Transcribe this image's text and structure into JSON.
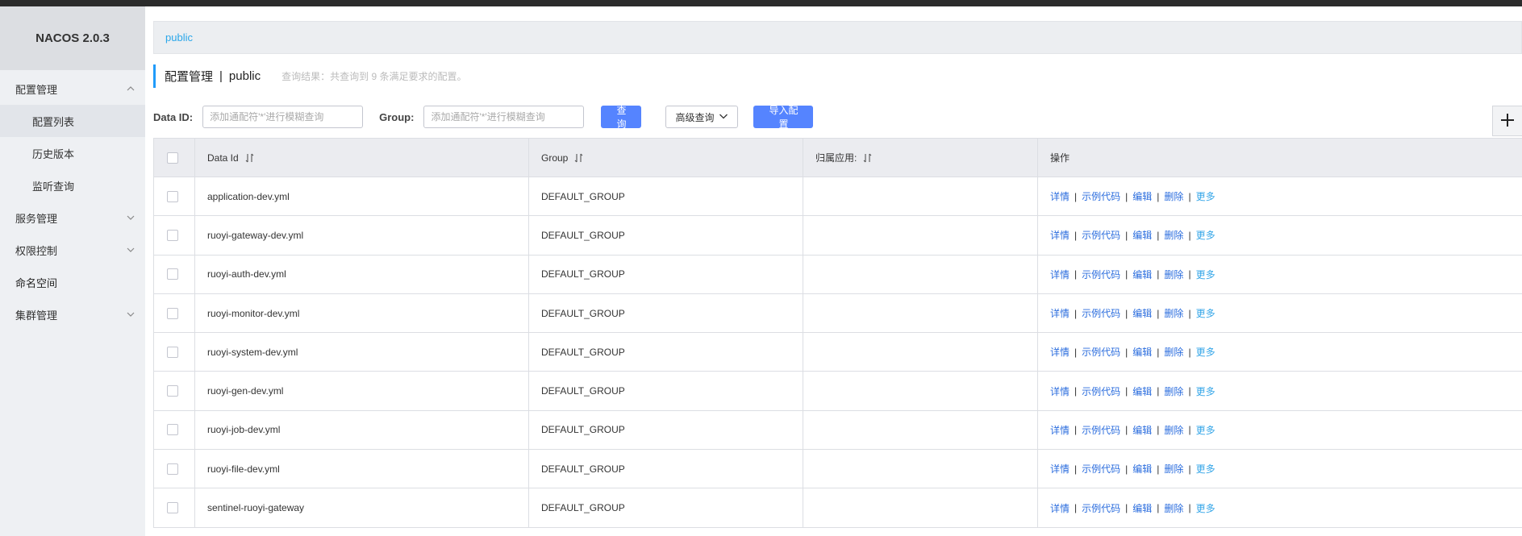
{
  "app": {
    "brand": "NACOS 2.0.3"
  },
  "sidebar": {
    "items": [
      {
        "label": "配置管理",
        "expanded": true
      },
      {
        "label": "配置列表",
        "sub": true,
        "active": true
      },
      {
        "label": "历史版本",
        "sub": true
      },
      {
        "label": "监听查询",
        "sub": true
      },
      {
        "label": "服务管理",
        "expanded": false
      },
      {
        "label": "权限控制",
        "expanded": false
      },
      {
        "label": "命名空间"
      },
      {
        "label": "集群管理",
        "expanded": false
      }
    ]
  },
  "namespace_bar": {
    "active": "public"
  },
  "page_header": {
    "title": "配置管理",
    "separator": "|",
    "namespace": "public",
    "result_hint": "查询结果：共查询到 9 条满足要求的配置。"
  },
  "filters": {
    "data_id_label": "Data ID:",
    "data_id_placeholder": "添加通配符'*'进行模糊查询",
    "group_label": "Group:",
    "group_placeholder": "添加通配符'*'进行模糊查询",
    "query_button": "查询",
    "advanced_button": "高级查询",
    "import_button": "导入配置"
  },
  "table": {
    "columns": [
      "Data Id",
      "Group",
      "归属应用:",
      "操作"
    ],
    "actions": [
      "详情",
      "示例代码",
      "编辑",
      "删除",
      "更多"
    ],
    "rows": [
      {
        "data_id": "application-dev.yml",
        "group": "DEFAULT_GROUP",
        "app": ""
      },
      {
        "data_id": "ruoyi-gateway-dev.yml",
        "group": "DEFAULT_GROUP",
        "app": ""
      },
      {
        "data_id": "ruoyi-auth-dev.yml",
        "group": "DEFAULT_GROUP",
        "app": ""
      },
      {
        "data_id": "ruoyi-monitor-dev.yml",
        "group": "DEFAULT_GROUP",
        "app": ""
      },
      {
        "data_id": "ruoyi-system-dev.yml",
        "group": "DEFAULT_GROUP",
        "app": ""
      },
      {
        "data_id": "ruoyi-gen-dev.yml",
        "group": "DEFAULT_GROUP",
        "app": ""
      },
      {
        "data_id": "ruoyi-job-dev.yml",
        "group": "DEFAULT_GROUP",
        "app": ""
      },
      {
        "data_id": "ruoyi-file-dev.yml",
        "group": "DEFAULT_GROUP",
        "app": ""
      },
      {
        "data_id": "sentinel-ruoyi-gateway",
        "group": "DEFAULT_GROUP",
        "app": ""
      }
    ]
  },
  "colors": {
    "primary": "#5584ff",
    "link": "#2b6dde",
    "more_link": "#35a6e8",
    "accent": "#209bfa"
  }
}
